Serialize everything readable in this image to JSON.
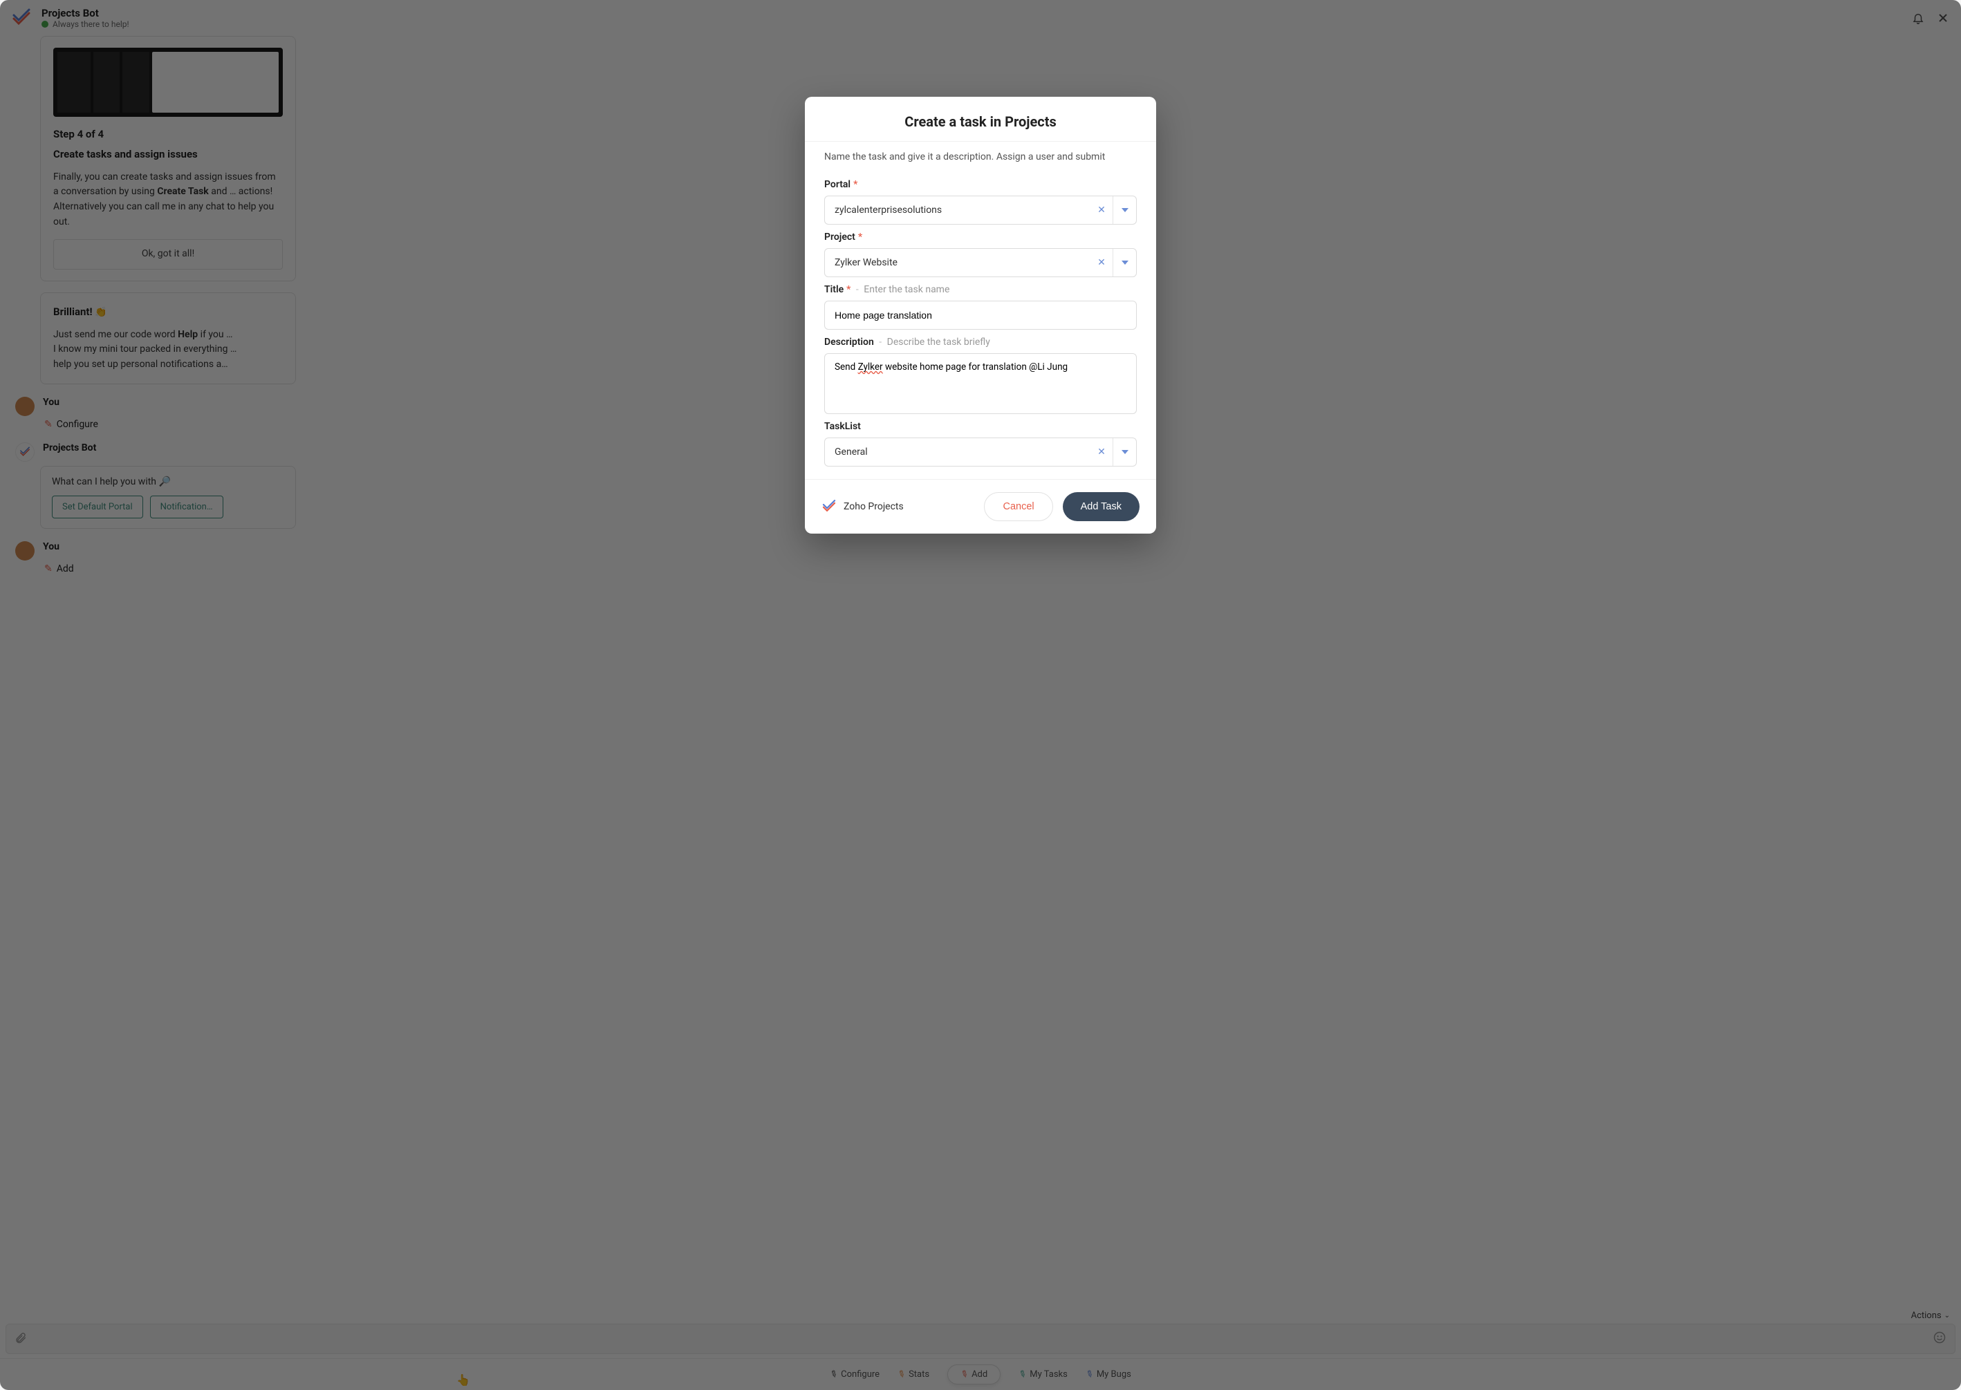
{
  "header": {
    "title": "Projects Bot",
    "subtitle": "Always there to help!"
  },
  "chat": {
    "step_card": {
      "step": "Step 4 of 4",
      "title": "Create tasks and assign issues",
      "body1_a": "Finally, you can create tasks and assign issues from a conversation by using ",
      "body1_b": "Create Task",
      "body1_c": " and … actions!",
      "body2": "Alternatively you can call me in any chat to help you out.",
      "ok": "Ok, got it all!"
    },
    "brilliant_card": {
      "head": "Brilliant!",
      "emoji": "👏",
      "line1_a": "Just send me our code word ",
      "line1_b": "Help",
      "line1_c": " if you …",
      "line2": "I know my mini tour packed in everything …",
      "line3": "help you set up personal notifications a…"
    },
    "you1": {
      "sender": "You",
      "cmd": "Configure"
    },
    "bot": {
      "sender": "Projects Bot",
      "question": "What can I help you with",
      "question_emoji": "🔎",
      "chips": [
        "Set Default Portal",
        "Notification…"
      ]
    },
    "you2": {
      "sender": "You",
      "cmd": "Add"
    }
  },
  "composer": {
    "actions": "Actions",
    "placeholder": ""
  },
  "toolbar": {
    "configure": "Configure",
    "stats": "Stats",
    "add": "Add",
    "my_tasks": "My Tasks",
    "my_bugs": "My Bugs"
  },
  "modal": {
    "title": "Create a task in Projects",
    "subtitle": "Name the task and give it a description. Assign a user and submit",
    "portal": {
      "label": "Portal",
      "value": "zylcalenterprisesolutions"
    },
    "project": {
      "label": "Project",
      "value": "Zylker Website"
    },
    "title_field": {
      "label": "Title",
      "hint": "Enter the task name",
      "value": "Home page translation"
    },
    "description": {
      "label": "Description",
      "hint": "Describe the task briefly",
      "value_pre": "Send ",
      "value_err": "Zylker",
      "value_post": " website home page for translation @Li Jung"
    },
    "tasklist": {
      "label": "TaskList",
      "value": "General"
    },
    "brand": "Zoho Projects",
    "cancel": "Cancel",
    "submit": "Add Task"
  }
}
